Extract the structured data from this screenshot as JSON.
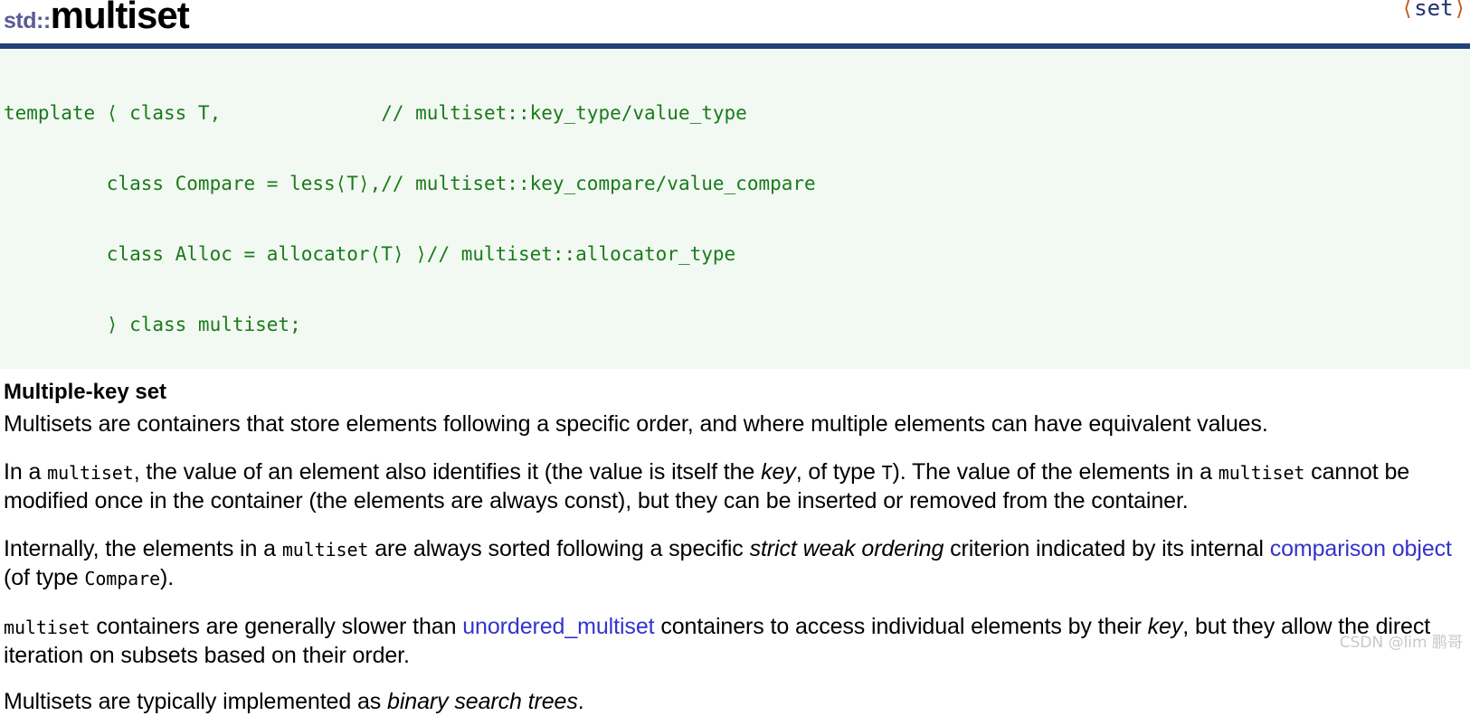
{
  "header": {
    "namespace": "std::",
    "name": "multiset",
    "include_open": "⟨",
    "include_name": "set",
    "include_close": "⟩"
  },
  "signature": {
    "lines": [
      {
        "code": "template ⟨ class T,",
        "comment": "// multiset::key_type/value_type"
      },
      {
        "code": "         class Compare = less⟨T⟩,",
        "comment": "// multiset::key_compare/value_compare"
      },
      {
        "code": "         class Alloc = allocator⟨T⟩ ⟩",
        "comment": "// multiset::allocator_type"
      },
      {
        "code": "         ⟩ class multiset;",
        "comment": ""
      }
    ]
  },
  "content": {
    "heading": "Multiple-key set",
    "p1": {
      "text": "Multisets are containers that store elements following a specific order, and where multiple elements can have equivalent values."
    },
    "p2": {
      "s1": "In a ",
      "code1": "multiset",
      "s2": ", the value of an element also identifies it (the value is itself the ",
      "em1": "key",
      "s3": ", of type ",
      "code2": "T",
      "s4": "). The value of the elements in a ",
      "code3": "multiset",
      "s5": " cannot be modified once in the container (the elements are always const), but they can be inserted or removed from the container."
    },
    "p3": {
      "s1": "Internally, the elements in a ",
      "code1": "multiset",
      "s2": " are always sorted following a specific ",
      "em1": "strict weak ordering",
      "s3": " criterion indicated by its internal ",
      "link1": "comparison object",
      "s4": " (of type ",
      "code2": "Compare",
      "s5": ")."
    },
    "p4": {
      "code1": "multiset",
      "s1": " containers are generally slower than ",
      "link1": "unordered_multiset",
      "s2": " containers to access individual elements by their ",
      "em1": "key",
      "s3": ", but they allow the direct iteration on subsets based on their order."
    },
    "p5": {
      "s1": "Multisets are typically implemented as ",
      "em1": "binary search trees",
      "s2": "."
    }
  },
  "watermark": {
    "text": "CSDN @lim 鹏哥"
  },
  "colors": {
    "rule": "#20417a",
    "namespace": "#5a5a96",
    "code_text": "#1a7a1a",
    "code_bg": "#f2f8f2",
    "link": "#3333cc",
    "include_angle": "#c06020",
    "include_name": "#203070"
  }
}
